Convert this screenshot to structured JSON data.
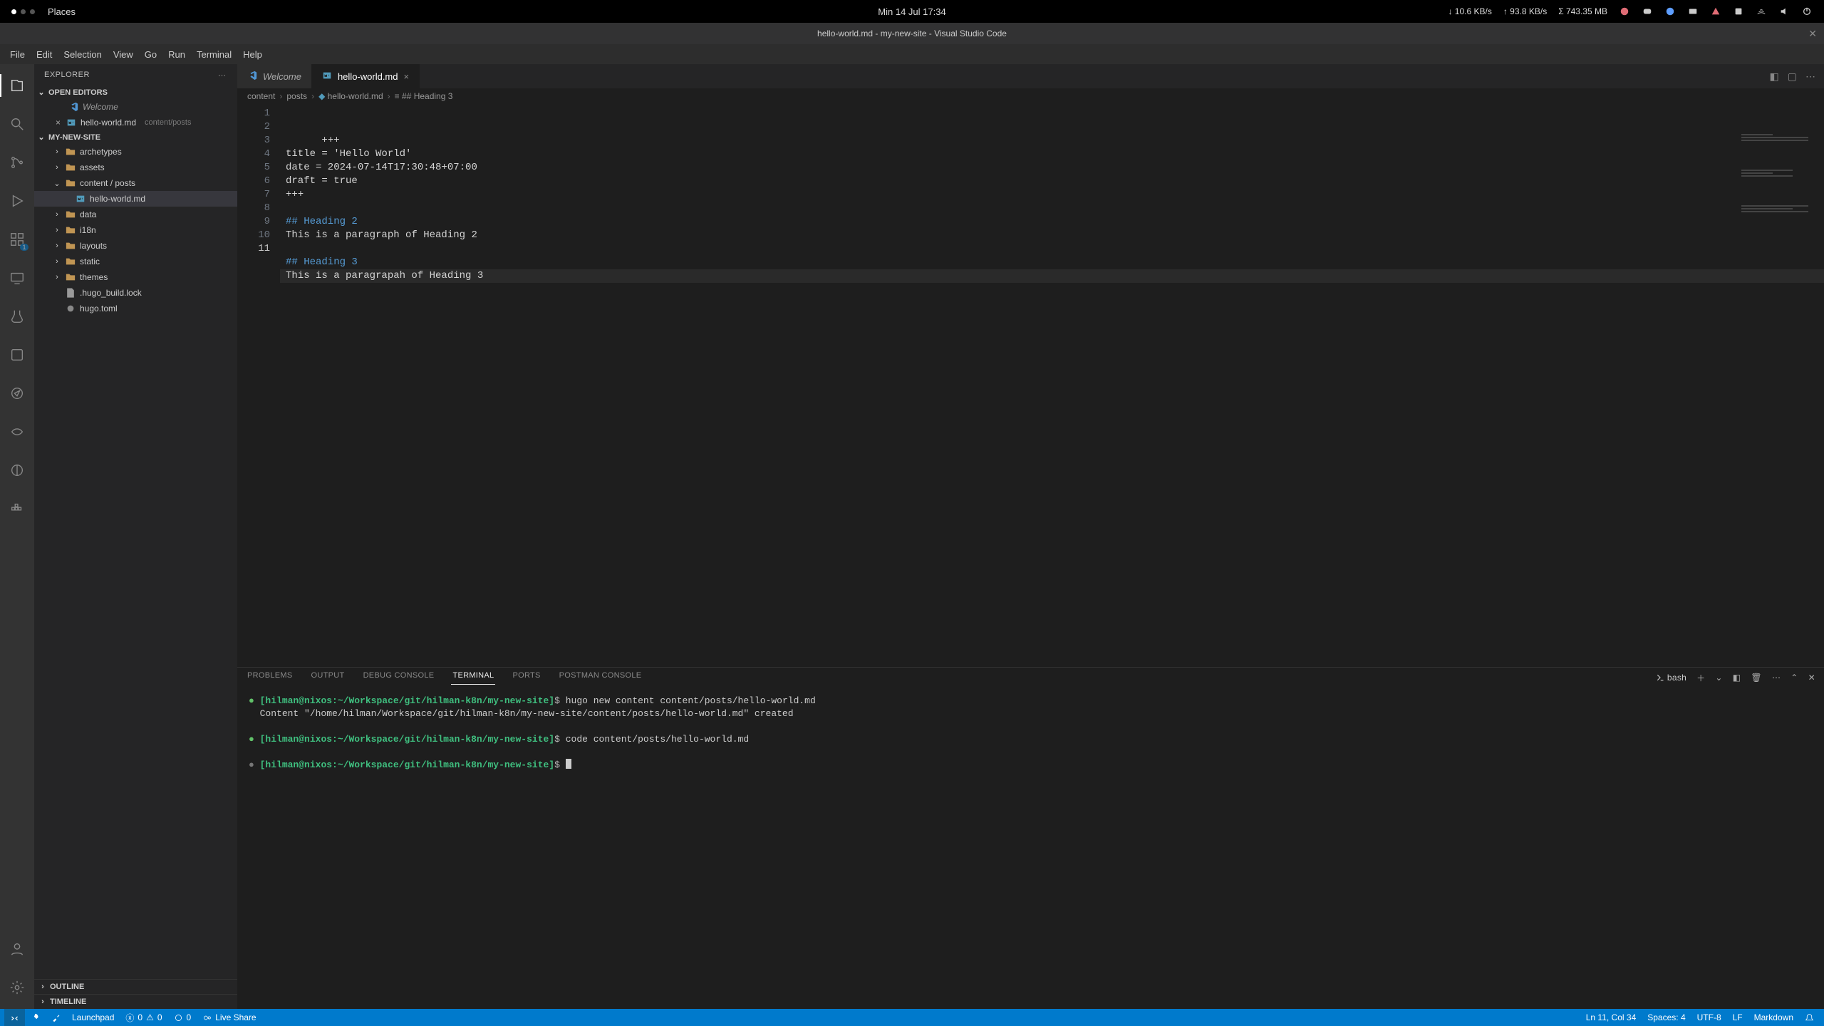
{
  "system": {
    "places": "Places",
    "clock": "Min 14 Jul  17:34",
    "net_down": "↓  10.6 KB/s",
    "net_up": "↑  93.8 KB/s",
    "mem": "Σ  743.35 MB"
  },
  "window": {
    "title": "hello-world.md - my-new-site - Visual Studio Code"
  },
  "menu": [
    "File",
    "Edit",
    "Selection",
    "View",
    "Go",
    "Run",
    "Terminal",
    "Help"
  ],
  "activity": {
    "badge_ext": "1"
  },
  "sidebar": {
    "title": "EXPLORER",
    "open_editors_label": "OPEN EDITORS",
    "open_editors": [
      {
        "label": "Welcome",
        "kind": "welcome",
        "italic": true
      },
      {
        "label": "hello-world.md",
        "kind": "md",
        "hint": "content/posts",
        "closable": true
      }
    ],
    "project_label": "MY-NEW-SITE",
    "tree": [
      {
        "label": "archetypes",
        "kind": "folder",
        "depth": 1
      },
      {
        "label": "assets",
        "kind": "folder",
        "depth": 1
      },
      {
        "label": "content / posts",
        "kind": "folder",
        "depth": 1,
        "expanded": true
      },
      {
        "label": "hello-world.md",
        "kind": "md",
        "depth": 2,
        "selected": true
      },
      {
        "label": "data",
        "kind": "folder",
        "depth": 1
      },
      {
        "label": "i18n",
        "kind": "folder",
        "depth": 1
      },
      {
        "label": "layouts",
        "kind": "folder",
        "depth": 1
      },
      {
        "label": "static",
        "kind": "folder",
        "depth": 1
      },
      {
        "label": "themes",
        "kind": "folder",
        "depth": 1
      },
      {
        "label": ".hugo_build.lock",
        "kind": "file",
        "depth": 1
      },
      {
        "label": "hugo.toml",
        "kind": "toml",
        "depth": 1
      }
    ],
    "outline": "OUTLINE",
    "timeline": "TIMELINE"
  },
  "tabs": [
    {
      "label": "Welcome",
      "kind": "welcome",
      "italic": true,
      "active": false
    },
    {
      "label": "hello-world.md",
      "kind": "md",
      "active": true
    }
  ],
  "breadcrumbs": [
    "content",
    "posts",
    "hello-world.md",
    "## Heading 3"
  ],
  "editor": {
    "lines": [
      {
        "n": 1,
        "cls": "tok-plain",
        "text": "+++"
      },
      {
        "n": 2,
        "cls": "tok-plain",
        "text": "title = 'Hello World'"
      },
      {
        "n": 3,
        "cls": "tok-plain",
        "text": "date = 2024-07-14T17:30:48+07:00"
      },
      {
        "n": 4,
        "cls": "tok-plain",
        "text": "draft = true"
      },
      {
        "n": 5,
        "cls": "tok-plain",
        "text": "+++"
      },
      {
        "n": 6,
        "cls": "tok-plain",
        "text": ""
      },
      {
        "n": 7,
        "cls": "tok-head",
        "text": "## Heading 2"
      },
      {
        "n": 8,
        "cls": "tok-plain",
        "text": "This is a paragraph of Heading 2"
      },
      {
        "n": 9,
        "cls": "tok-plain",
        "text": ""
      },
      {
        "n": 10,
        "cls": "tok-head",
        "text": "## Heading 3"
      },
      {
        "n": 11,
        "cls": "tok-plain",
        "text": "This is a paragrapah of Heading 3",
        "current": true
      }
    ]
  },
  "panel": {
    "tabs": [
      "PROBLEMS",
      "OUTPUT",
      "DEBUG CONSOLE",
      "TERMINAL",
      "PORTS",
      "POSTMAN CONSOLE"
    ],
    "active_tab": "TERMINAL",
    "shell": "bash",
    "terminal": [
      {
        "bullet": "green",
        "prompt": "[hilman@nixos:~/Workspace/git/hilman-k8n/my-new-site]$",
        "cmd": "hugo new content content/posts/hello-world.md"
      },
      {
        "out": "Content \"/home/hilman/Workspace/git/hilman-k8n/my-new-site/content/posts/hello-world.md\" created"
      },
      {
        "spacer": true
      },
      {
        "bullet": "green",
        "prompt": "[hilman@nixos:~/Workspace/git/hilman-k8n/my-new-site]$",
        "cmd": "code content/posts/hello-world.md"
      },
      {
        "spacer": true
      },
      {
        "bullet": "grey",
        "prompt": "[hilman@nixos:~/Workspace/git/hilman-k8n/my-new-site]$",
        "cursor": true
      }
    ]
  },
  "status": {
    "launchpad": "Launchpad",
    "diag": "0",
    "warn": "0",
    "ports": "0",
    "liveshare": "Live Share",
    "cursor": "Ln 11, Col 34",
    "spaces": "Spaces: 4",
    "encoding": "UTF-8",
    "eol": "LF",
    "lang": "Markdown"
  }
}
